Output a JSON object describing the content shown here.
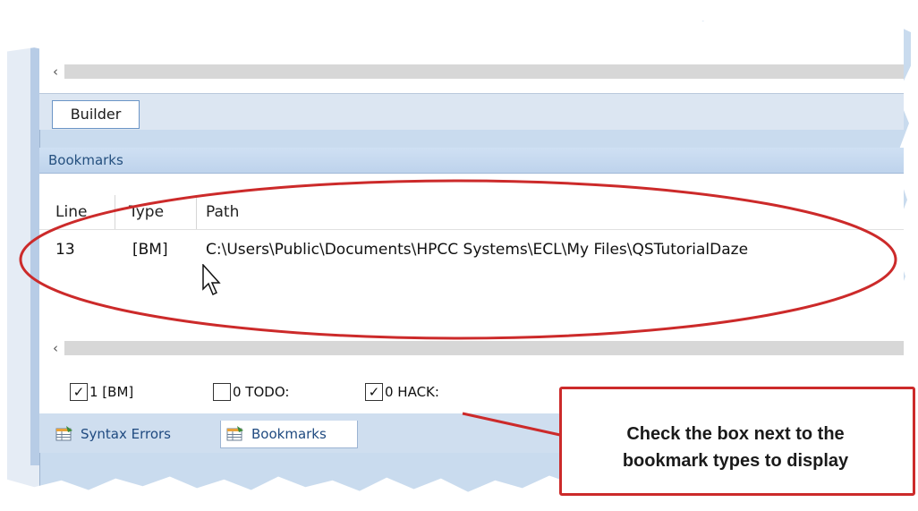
{
  "builder": {
    "label": "Builder"
  },
  "bookmarks": {
    "title": "Bookmarks",
    "columns": [
      "Line",
      "Type",
      "Path"
    ],
    "rows": [
      {
        "line": "13",
        "type": "[BM]",
        "path": "C:\\Users\\Public\\Documents\\HPCC Systems\\ECL\\My Files\\QSTutorialDaze"
      }
    ],
    "filters": [
      {
        "label": "1 [BM]",
        "checked": true
      },
      {
        "label": "0 TODO:",
        "checked": false
      },
      {
        "label": "0 HACK:",
        "checked": true
      }
    ]
  },
  "tabs": [
    {
      "label": "Syntax Errors",
      "icon": "table-grid-icon"
    },
    {
      "label": "Bookmarks",
      "icon": "table-grid-icon",
      "active": true
    }
  ],
  "callout": {
    "line1": "Check the box next to the",
    "line2": "bookmark types to display"
  },
  "colors": {
    "annotation": "#cc2a2a",
    "panel_header": "#c7daf0",
    "accent_text": "#25507f"
  }
}
